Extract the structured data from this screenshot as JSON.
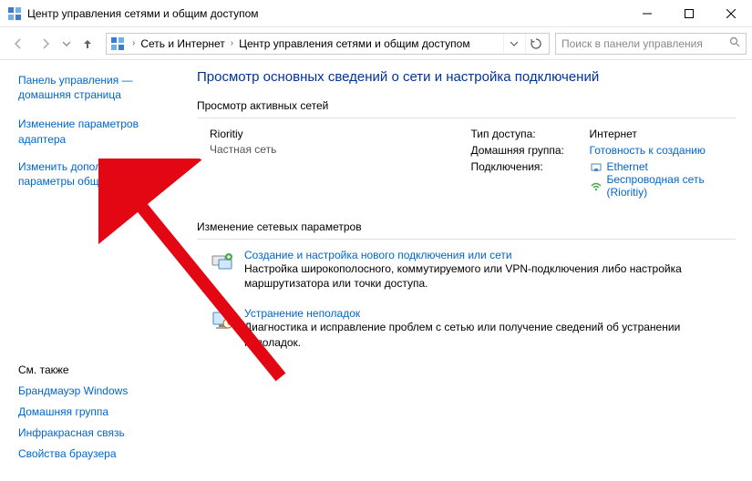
{
  "window": {
    "title": "Центр управления сетями и общим доступом"
  },
  "nav": {
    "breadcrumb": {
      "seg1": "Сеть и Интернет",
      "seg2": "Центр управления сетями и общим доступом"
    },
    "search_placeholder": "Поиск в панели управления"
  },
  "sidebar": {
    "home": "Панель управления — домашняя страница",
    "link1": "Изменение параметров адаптера",
    "link2": "Изменить дополнительные параметры общего доступа",
    "see_also": "См. также",
    "bl1": "Брандмауэр Windows",
    "bl2": "Домашняя группа",
    "bl3": "Инфракрасная связь",
    "bl4": "Свойства браузера"
  },
  "main": {
    "page_title": "Просмотр основных сведений о сети и настройка подключений",
    "active_networks": "Просмотр активных сетей",
    "network": {
      "name": "Rioritiy",
      "type": "Частная сеть",
      "access_type_label": "Тип доступа:",
      "access_type_value": "Интернет",
      "homegroup_label": "Домашняя группа:",
      "homegroup_value": "Готовность к созданию",
      "connections_label": "Подключения:",
      "conn1": "Ethernet",
      "conn2": "Беспроводная сеть (Rioritiy)"
    },
    "change_settings": "Изменение сетевых параметров",
    "item1": {
      "title": "Создание и настройка нового подключения или сети",
      "desc": "Настройка широкополосного, коммутируемого или VPN-подключения либо настройка маршрутизатора или точки доступа."
    },
    "item2": {
      "title": "Устранение неполадок",
      "desc": "Диагностика и исправление проблем с сетью или получение сведений об устранении неполадок."
    }
  }
}
